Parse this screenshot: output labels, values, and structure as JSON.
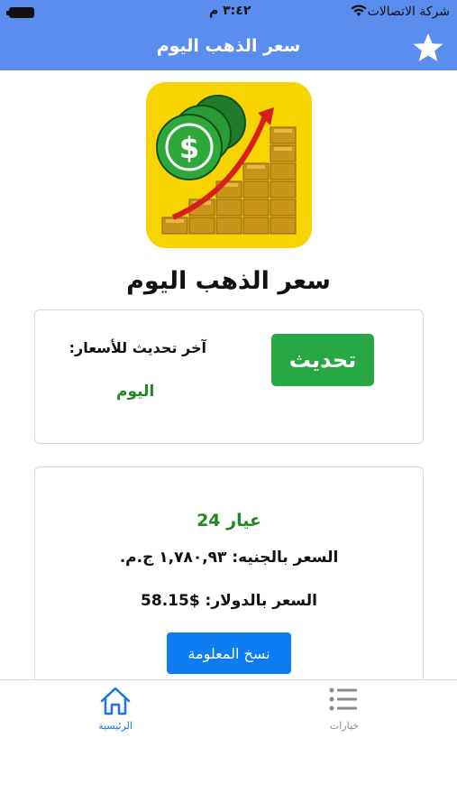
{
  "status_bar": {
    "carrier": "شركة الاتصالات",
    "time": "٣:٤٢ م"
  },
  "nav": {
    "title": "سعر الذهب اليوم",
    "star_icon": "star-icon"
  },
  "app_icon": "gold-price-app-icon",
  "heading": "سعر الذهب اليوم",
  "update_card": {
    "refresh_label": "تحديث",
    "last_update_label": "آخر تحديث للأسعار:",
    "last_update_value": "اليوم"
  },
  "price_card": {
    "karat": "عيار 24",
    "price_egp": "السعر بالجنيه: ١,٧٨٠,٩٣ ج.م.",
    "price_usd": "السعر بالدولار: $58.15",
    "copy_label": "نسخ المعلومة"
  },
  "tabs": [
    {
      "label": "الرئيسية",
      "icon": "home-icon",
      "active": true
    },
    {
      "label": "خيارات",
      "icon": "list-icon",
      "active": false
    }
  ],
  "colors": {
    "nav": "#5b8def",
    "refresh_button": "#28a745",
    "copy_button": "#0d7cf2",
    "green_text": "#1e8a1e",
    "active_tab": "#1a73e8"
  }
}
